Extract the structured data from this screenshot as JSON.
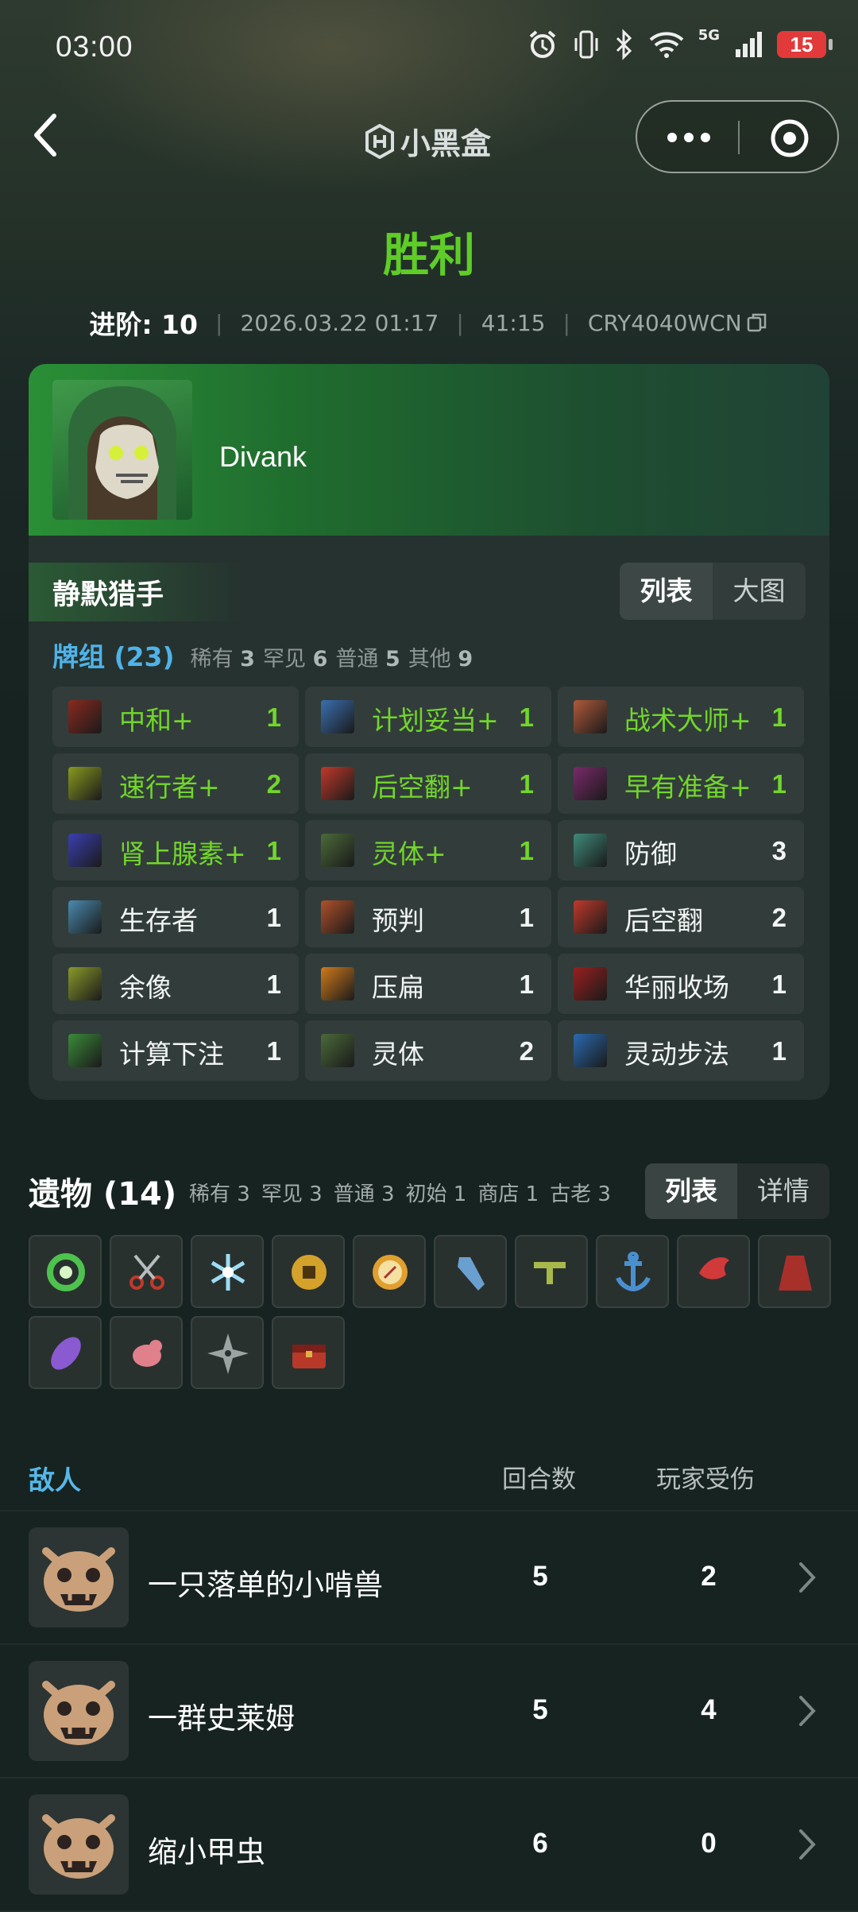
{
  "status_bar": {
    "time": "03:00",
    "network": "5G",
    "battery": "15"
  },
  "nav": {
    "brand": "小黑盒"
  },
  "result": {
    "title": "胜利",
    "color": "#5fcc28"
  },
  "meta": {
    "level_label": "进阶: 10",
    "datetime": "2026.03.22 01:17",
    "duration": "41:15",
    "seed": "CRY4040WCN"
  },
  "character": {
    "name": "Divank",
    "class": "静默猎手"
  },
  "deck_view_toggle": {
    "list": "列表",
    "big": "大图",
    "selected": "列表"
  },
  "deck": {
    "title": "牌组 (23)",
    "stats": [
      {
        "label": "稀有",
        "value": "3"
      },
      {
        "label": "罕见",
        "value": "6"
      },
      {
        "label": "普通",
        "value": "5"
      },
      {
        "label": "其他",
        "value": "9"
      }
    ],
    "cards": [
      {
        "name": "中和+",
        "count": "1",
        "upgraded": true,
        "icon": "card-art-icon",
        "color": "#8a2a1f"
      },
      {
        "name": "计划妥当+",
        "count": "1",
        "upgraded": true,
        "icon": "card-art-icon",
        "color": "#3a6fb0"
      },
      {
        "name": "战术大师+",
        "count": "1",
        "upgraded": true,
        "icon": "card-art-icon",
        "color": "#b05a3a"
      },
      {
        "name": "速行者+",
        "count": "2",
        "upgraded": true,
        "icon": "card-art-icon",
        "color": "#8a9a1e"
      },
      {
        "name": "后空翻+",
        "count": "1",
        "upgraded": true,
        "icon": "card-art-icon",
        "color": "#c0392b"
      },
      {
        "name": "早有准备+",
        "count": "1",
        "upgraded": true,
        "icon": "card-art-icon",
        "color": "#7a2a6a"
      },
      {
        "name": "肾上腺素+",
        "count": "1",
        "upgraded": true,
        "icon": "card-art-icon",
        "color": "#3a3fb0"
      },
      {
        "name": "灵体+",
        "count": "1",
        "upgraded": true,
        "icon": "card-art-icon",
        "color": "#4c6a3a"
      },
      {
        "name": "防御",
        "count": "3",
        "upgraded": false,
        "icon": "card-art-icon",
        "color": "#3f8a7a"
      },
      {
        "name": "生存者",
        "count": "1",
        "upgraded": false,
        "icon": "card-art-icon",
        "color": "#4a8ab0"
      },
      {
        "name": "预判",
        "count": "1",
        "upgraded": false,
        "icon": "card-art-icon",
        "color": "#b0502a"
      },
      {
        "name": "后空翻",
        "count": "2",
        "upgraded": false,
        "icon": "card-art-icon",
        "color": "#c0392b"
      },
      {
        "name": "余像",
        "count": "1",
        "upgraded": false,
        "icon": "card-art-icon",
        "color": "#8a9a2a"
      },
      {
        "name": "压扁",
        "count": "1",
        "upgraded": false,
        "icon": "card-art-icon",
        "color": "#d07a1a"
      },
      {
        "name": "华丽收场",
        "count": "1",
        "upgraded": false,
        "icon": "card-art-icon",
        "color": "#9a1f1f"
      },
      {
        "name": "计算下注",
        "count": "1",
        "upgraded": false,
        "icon": "card-art-icon",
        "color": "#3a8a3a"
      },
      {
        "name": "灵体",
        "count": "2",
        "upgraded": false,
        "icon": "card-art-icon",
        "color": "#4c6a3a"
      },
      {
        "name": "灵动步法",
        "count": "1",
        "upgraded": false,
        "icon": "card-art-icon",
        "color": "#2a6ab0"
      }
    ]
  },
  "relics": {
    "title": "遗物 (14)",
    "stats": [
      {
        "label": "稀有",
        "value": "3"
      },
      {
        "label": "罕见",
        "value": "3"
      },
      {
        "label": "普通",
        "value": "3"
      },
      {
        "label": "初始",
        "value": "1"
      },
      {
        "label": "商店",
        "value": "1"
      },
      {
        "label": "古老",
        "value": "3"
      }
    ],
    "toggle": {
      "list": "列表",
      "detail": "详情",
      "selected": "列表"
    },
    "items": [
      {
        "icon": "ring-relic-icon",
        "color": "#4ec24e"
      },
      {
        "icon": "scissors-relic-icon",
        "color": "#c0392b"
      },
      {
        "icon": "snowflake-relic-icon",
        "color": "#9fdcf5"
      },
      {
        "icon": "coin-relic-icon",
        "color": "#d4a22a"
      },
      {
        "icon": "compass-relic-icon",
        "color": "#e0a030"
      },
      {
        "icon": "vial-relic-icon",
        "color": "#6aa0d0"
      },
      {
        "icon": "gun-relic-icon",
        "color": "#a8b84a"
      },
      {
        "icon": "anchor-relic-icon",
        "color": "#4a90d0"
      },
      {
        "icon": "bird-relic-icon",
        "color": "#d03a3a"
      },
      {
        "icon": "cloak-relic-icon",
        "color": "#a8302a"
      },
      {
        "icon": "leaf-relic-icon",
        "color": "#8a5ad0"
      },
      {
        "icon": "pig-relic-icon",
        "color": "#e0808a"
      },
      {
        "icon": "shuriken-relic-icon",
        "color": "#9aa4a2"
      },
      {
        "icon": "chest-relic-icon",
        "color": "#b8382a"
      }
    ]
  },
  "enemies": {
    "title": "敌人",
    "col_turns": "回合数",
    "col_damage": "玩家受伤",
    "rows": [
      {
        "name": "一只落单的小啃兽",
        "turns": "5",
        "damage": "2"
      },
      {
        "name": "一群史莱姆",
        "turns": "5",
        "damage": "4"
      },
      {
        "name": "缩小甲虫",
        "turns": "6",
        "damage": "0"
      }
    ]
  }
}
